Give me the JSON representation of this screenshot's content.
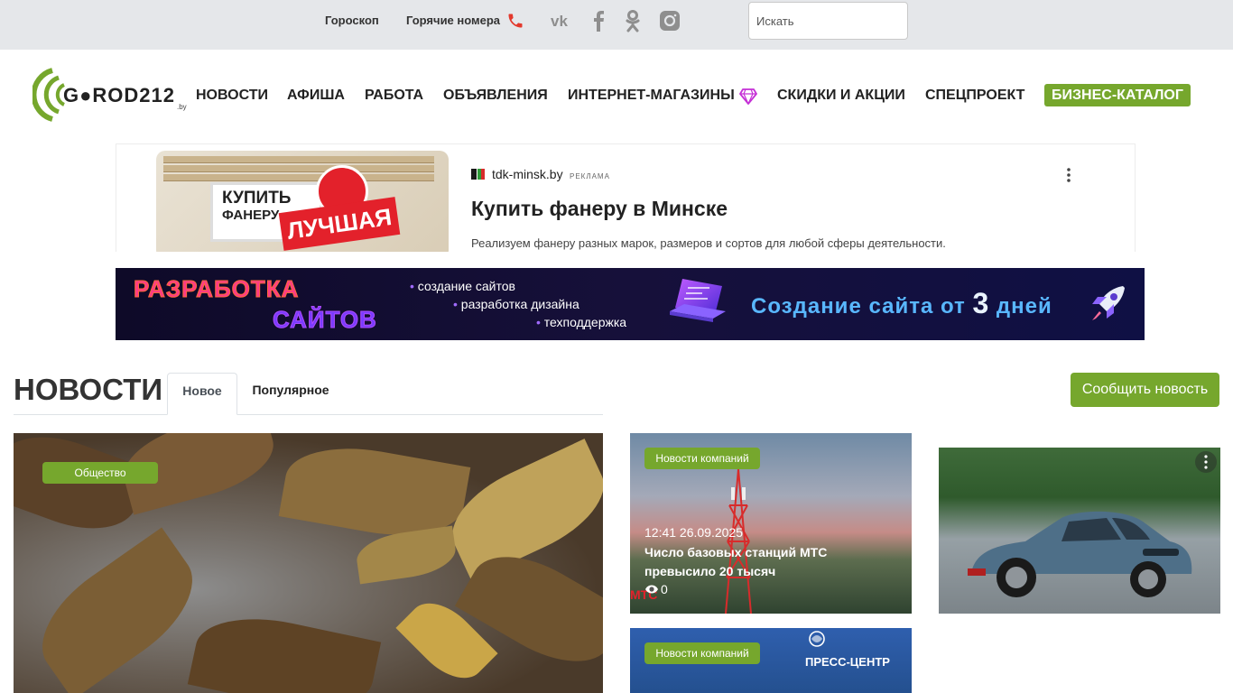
{
  "topbar": {
    "horoscope": "Гороскоп",
    "hotlines": "Горячие номера",
    "phone_icon": "phone-icon",
    "social_icons": [
      "vk-icon",
      "facebook-icon",
      "odnoklassniki-icon",
      "instagram-icon"
    ],
    "search_placeholder": "Искать"
  },
  "header": {
    "logo_text": "G●ROD212",
    "logo_suffix": ".by",
    "nav": [
      "НОВОСТИ",
      "АФИША",
      "РАБОТА",
      "ОБЪЯВЛЕНИЯ",
      "ИНТЕРНЕТ-МАГАЗИНЫ",
      "СКИДКИ И АКЦИИ",
      "СПЕЦПРОЕКТ"
    ],
    "catalog": "БИЗНЕС-КАТАЛОГ",
    "accent": "#76a72d"
  },
  "ad": {
    "domain": "tdk-minsk.by",
    "tag": "РЕКЛАМА",
    "title": "Купить фанеру в Минске",
    "description": "Реализуем фанеру разных марок, размеров и сортов для любой сферы деятельности.",
    "image_text_1": "КУПИТЬ",
    "image_text_2": "ФАНЕРУ",
    "image_badge": "ЛУЧШАЯ"
  },
  "banner": {
    "title_1": "РАЗРАБОТКА",
    "title_2": "САЙТОВ",
    "items": [
      "создание сайтов",
      "разработка дизайна",
      "техподдержка"
    ],
    "cta_prefix": "Создание сайта от",
    "cta_number": "3",
    "cta_suffix": "дней"
  },
  "news": {
    "title": "НОВОСТИ",
    "tabs": [
      "Новое",
      "Популярное"
    ],
    "report_button": "Сообщить новость",
    "main_card": {
      "category": "Общество"
    },
    "card_1": {
      "category": "Новости компаний",
      "time": "12:41 26.09.2025",
      "title": "Число базовых станций МТС превысило 20 тысяч",
      "views": "0",
      "image_logo": "МТС"
    },
    "card_2": {
      "category": "Новости компаний",
      "image_text": "ПРЕСС-ЦЕНТР"
    }
  }
}
